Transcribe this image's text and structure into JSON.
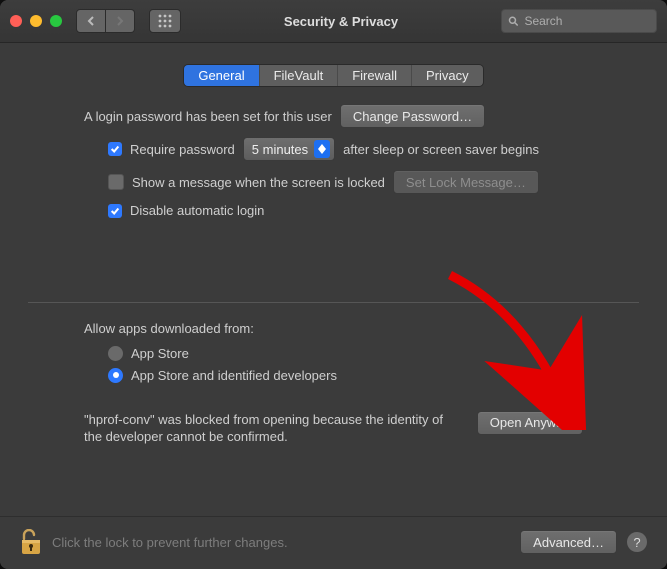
{
  "window": {
    "title": "Security & Privacy"
  },
  "search": {
    "placeholder": "Search"
  },
  "tabs": {
    "general": "General",
    "filevault": "FileVault",
    "firewall": "Firewall",
    "privacy": "Privacy"
  },
  "general": {
    "login_password_set": "A login password has been set for this user",
    "change_password_btn": "Change Password…",
    "require_password_label": "Require password",
    "require_password_delay": "5 minutes",
    "after_sleep_label": "after sleep or screen saver begins",
    "show_message_label": "Show a message when the screen is locked",
    "set_lock_message_btn": "Set Lock Message…",
    "disable_auto_login_label": "Disable automatic login"
  },
  "allow_apps": {
    "heading": "Allow apps downloaded from:",
    "option_app_store": "App Store",
    "option_identified": "App Store and identified developers",
    "blocked_message": "\"hprof-conv\" was blocked from opening because the identity of the developer cannot be confirmed.",
    "open_anyway_btn": "Open Anyway"
  },
  "footer": {
    "lock_text": "Click the lock to prevent further changes.",
    "advanced_btn": "Advanced…",
    "help_btn": "?"
  }
}
